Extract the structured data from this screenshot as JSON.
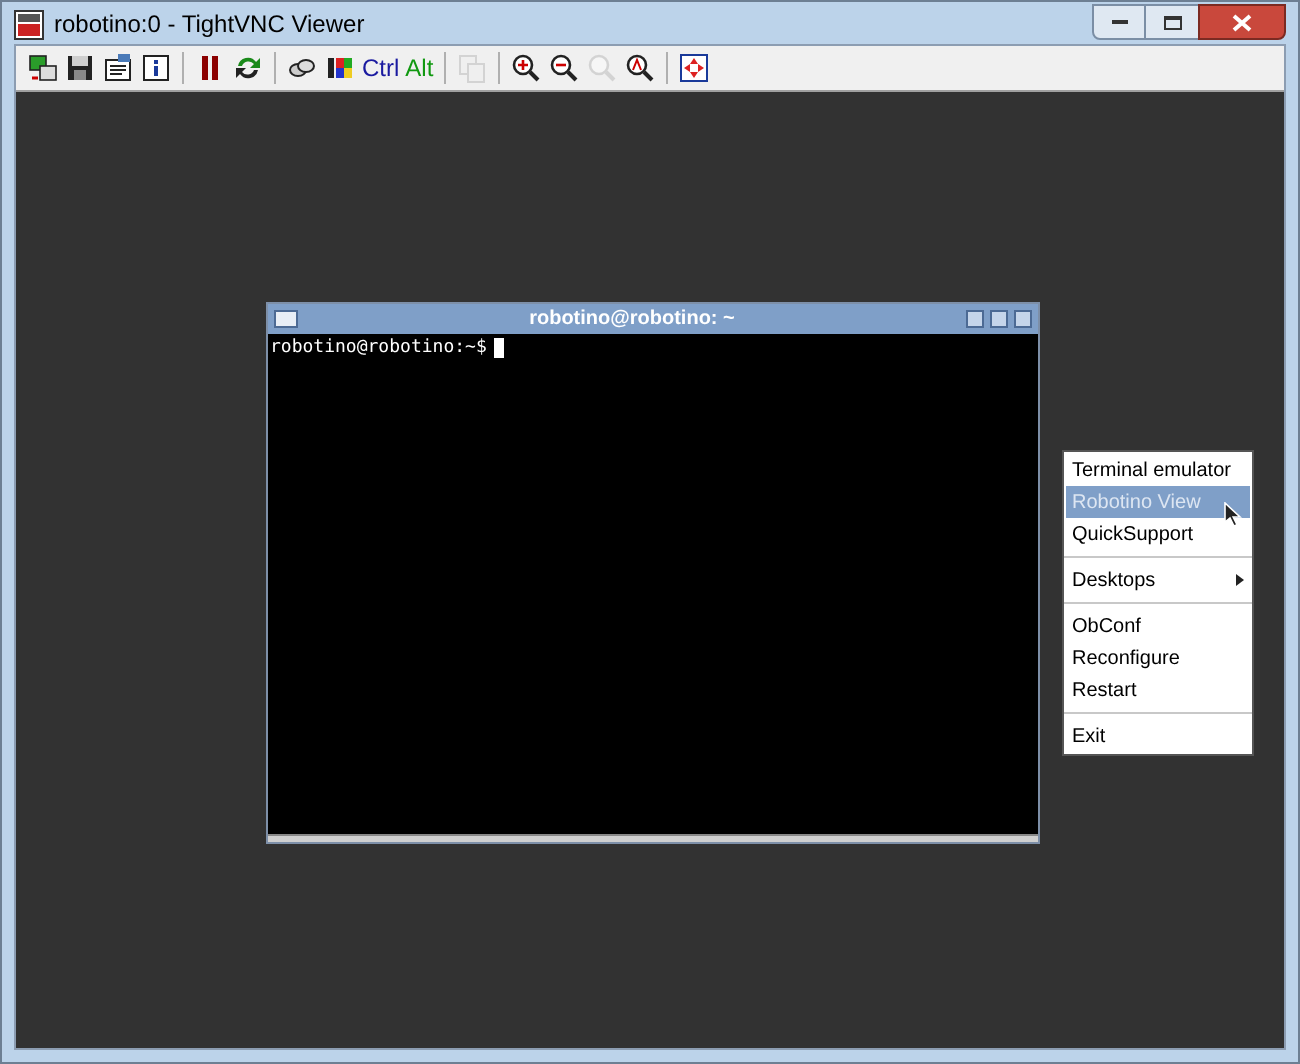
{
  "window": {
    "title": "robotino:0 - TightVNC Viewer"
  },
  "toolbar": [
    [
      {
        "kind": "icon",
        "disabled": false
      },
      {
        "kind": "icon",
        "disabled": false
      },
      {
        "kind": "icon",
        "disabled": false
      },
      {
        "kind": "icon",
        "disabled": false
      }
    ],
    [
      {
        "kind": "icon",
        "disabled": false
      },
      {
        "kind": "icon",
        "disabled": false
      }
    ],
    [
      {
        "kind": "icon",
        "disabled": false
      },
      {
        "kind": "icon",
        "disabled": false
      },
      {
        "kind": "text",
        "label": "Ctrl",
        "color": "#1a1aa0"
      },
      {
        "kind": "text",
        "label": "Alt",
        "color": "#119911"
      }
    ],
    [
      {
        "kind": "icon",
        "disabled": true
      }
    ],
    [
      {
        "kind": "icon",
        "disabled": false
      },
      {
        "kind": "icon",
        "disabled": false
      },
      {
        "kind": "icon",
        "disabled": true
      },
      {
        "kind": "icon",
        "disabled": false
      }
    ],
    [
      {
        "kind": "icon",
        "disabled": false
      }
    ]
  ],
  "terminal": {
    "title": "robotino@robotino: ~",
    "prompt": "robotino@robotino:~$"
  },
  "menu": [
    {
      "kind": "item",
      "label": "Terminal emulator",
      "selected": false
    },
    {
      "kind": "item",
      "label": "Robotino View",
      "selected": true
    },
    {
      "kind": "item",
      "label": "QuickSupport",
      "selected": false
    },
    {
      "kind": "separator"
    },
    {
      "kind": "submenu",
      "label": "Desktops",
      "selected": false
    },
    {
      "kind": "separator"
    },
    {
      "kind": "item",
      "label": "ObConf",
      "selected": false
    },
    {
      "kind": "item",
      "label": "Reconfigure",
      "selected": false
    },
    {
      "kind": "item",
      "label": "Restart",
      "selected": false
    },
    {
      "kind": "separator"
    },
    {
      "kind": "item",
      "label": "Exit",
      "selected": false
    }
  ]
}
